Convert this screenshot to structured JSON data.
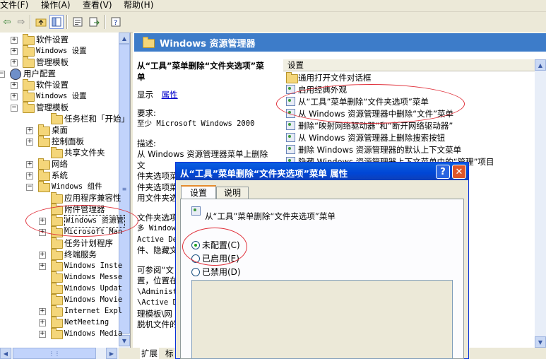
{
  "menu": {
    "file": "文件(F)",
    "action": "操作(A)",
    "view": "查看(V)",
    "help": "帮助(H)"
  },
  "icons": {
    "back": "back-arrow-icon",
    "forward": "forward-arrow-icon",
    "up": "up-folder-icon",
    "tree_toggle": "show-tree-icon",
    "properties": "properties-icon",
    "export": "export-list-icon",
    "help": "help-icon"
  },
  "tree": {
    "items": [
      {
        "label": "软件设置"
      },
      {
        "label": "Windows 设置"
      },
      {
        "label": "管理模板"
      },
      {
        "label": "用户配置"
      },
      {
        "label": "软件设置"
      },
      {
        "label": "Windows 设置"
      },
      {
        "label": "管理模板"
      },
      {
        "label": "任务栏和「开始」"
      },
      {
        "label": "桌面"
      },
      {
        "label": "控制面板"
      },
      {
        "label": "共享文件夹"
      },
      {
        "label": "网络"
      },
      {
        "label": "系统"
      },
      {
        "label": "Windows 组件"
      },
      {
        "label": "应用程序兼容性"
      },
      {
        "label": "附件管理器"
      },
      {
        "label": "Windows 资源管"
      },
      {
        "label": "Microsoft Man"
      },
      {
        "label": "任务计划程序"
      },
      {
        "label": "终端服务"
      },
      {
        "label": "Windows Inste"
      },
      {
        "label": "Windows Messe"
      },
      {
        "label": "Windows Updat"
      },
      {
        "label": "Windows Movie"
      },
      {
        "label": "Internet Expl"
      },
      {
        "label": "NetMeeting"
      },
      {
        "label": "Windows Media"
      }
    ]
  },
  "panel": {
    "title": "Windows 资源管理器"
  },
  "desc": {
    "heading": "从“工具”菜单删除“文件夹选项”菜单",
    "show": "显示",
    "link": "属性",
    "req_label": "要求:",
    "req_value": "至少 Microsoft Windows 2000",
    "desc_label": "描述:",
    "desc_lines": [
      "从 Windows 资源管理器菜单上删除文",
      "件夹选项菜",
      "件夹选项菜",
      "用文件夹选"
    ],
    "block2": [
      "文件夹选项",
      "多 Window",
      "Active De",
      "件、隐藏文"
    ],
    "block3": [
      "可参阅“文",
      "置，位置在",
      "\\Administ",
      "\\Active D",
      "理模板\\网",
      "脱机文件的"
    ]
  },
  "list": {
    "header": "设置",
    "items": [
      "通用打开文件对话框",
      "启用经典外观",
      "从“工具”菜单删除“文件夹选项”菜单",
      "从 Windows 资源管理器中删除“文件”菜单",
      "删除“映射网络驱动器”和“断开网络驱动器”",
      "从 Windows 资源管理器上删除搜索按钮",
      "删除 Windows 资源管理器的默认上下文菜单",
      "隐藏 Windows 资源管理器上下文菜单中的“管理”项目"
    ]
  },
  "dialog": {
    "title": "从“工具”菜单删除“文件夹选项”菜单 属性",
    "help_btn": "?",
    "close_btn": "✕",
    "tabs": [
      "设置",
      "说明"
    ],
    "setting_name": "从“工具”菜单删除“文件夹选项”菜单",
    "options": [
      "未配置(C)",
      "已启用(E)",
      "已禁用(D)"
    ],
    "selected": 0
  },
  "bottom_tabs": {
    "extended": "扩展",
    "standard": "标"
  }
}
